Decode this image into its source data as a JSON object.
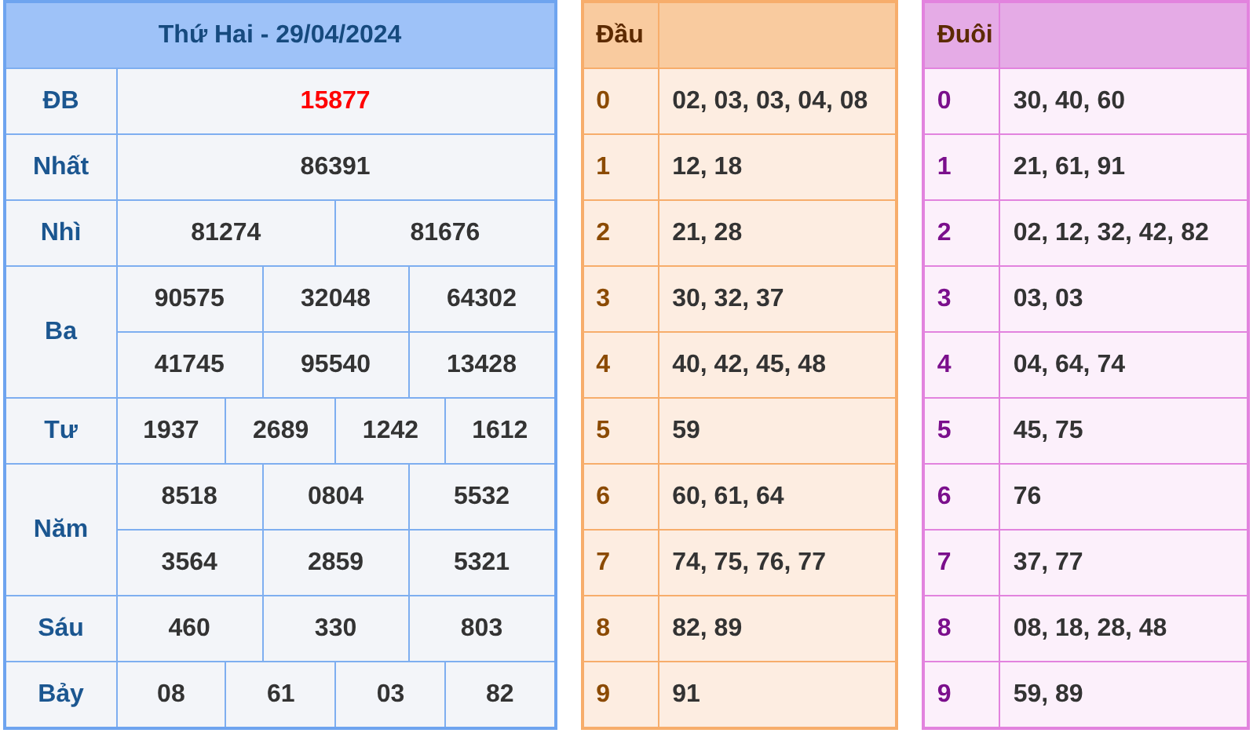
{
  "results": {
    "title": "Thứ Hai - 29/04/2024",
    "prizes": [
      {
        "label": "ĐB",
        "kind": "special",
        "rows": [
          [
            "15877"
          ]
        ]
      },
      {
        "label": "Nhất",
        "kind": "normal",
        "rows": [
          [
            "86391"
          ]
        ]
      },
      {
        "label": "Nhì",
        "kind": "normal",
        "rows": [
          [
            "81274",
            "81676"
          ]
        ]
      },
      {
        "label": "Ba",
        "kind": "normal",
        "rows": [
          [
            "90575",
            "32048",
            "64302"
          ],
          [
            "41745",
            "95540",
            "13428"
          ]
        ]
      },
      {
        "label": "Tư",
        "kind": "normal",
        "rows": [
          [
            "1937",
            "2689",
            "1242",
            "1612"
          ]
        ]
      },
      {
        "label": "Năm",
        "kind": "normal",
        "rows": [
          [
            "8518",
            "0804",
            "5532"
          ],
          [
            "3564",
            "2859",
            "5321"
          ]
        ]
      },
      {
        "label": "Sáu",
        "kind": "normal",
        "rows": [
          [
            "460",
            "330",
            "803"
          ]
        ]
      },
      {
        "label": "Bảy",
        "kind": "normal",
        "rows": [
          [
            "08",
            "61",
            "03",
            "82"
          ]
        ]
      }
    ]
  },
  "head_table": {
    "kind": "head",
    "title": "Đầu",
    "rows": [
      {
        "digit": "0",
        "numbers": "02, 03, 03, 04, 08"
      },
      {
        "digit": "1",
        "numbers": "12, 18"
      },
      {
        "digit": "2",
        "numbers": "21, 28"
      },
      {
        "digit": "3",
        "numbers": "30, 32, 37"
      },
      {
        "digit": "4",
        "numbers": "40, 42, 45, 48"
      },
      {
        "digit": "5",
        "numbers": "59"
      },
      {
        "digit": "6",
        "numbers": "60, 61, 64"
      },
      {
        "digit": "7",
        "numbers": "74, 75, 76, 77"
      },
      {
        "digit": "8",
        "numbers": "82, 89"
      },
      {
        "digit": "9",
        "numbers": "91"
      }
    ]
  },
  "tail_table": {
    "kind": "tail",
    "title": "Đuôi",
    "rows": [
      {
        "digit": "0",
        "numbers": "30, 40, 60"
      },
      {
        "digit": "1",
        "numbers": "21, 61, 91"
      },
      {
        "digit": "2",
        "numbers": "02, 12, 32, 42, 82"
      },
      {
        "digit": "3",
        "numbers": "03, 03"
      },
      {
        "digit": "4",
        "numbers": "04, 64, 74"
      },
      {
        "digit": "5",
        "numbers": "45, 75"
      },
      {
        "digit": "6",
        "numbers": "76"
      },
      {
        "digit": "7",
        "numbers": "37, 77"
      },
      {
        "digit": "8",
        "numbers": "08, 18, 28, 48"
      },
      {
        "digit": "9",
        "numbers": "59, 89"
      }
    ]
  }
}
